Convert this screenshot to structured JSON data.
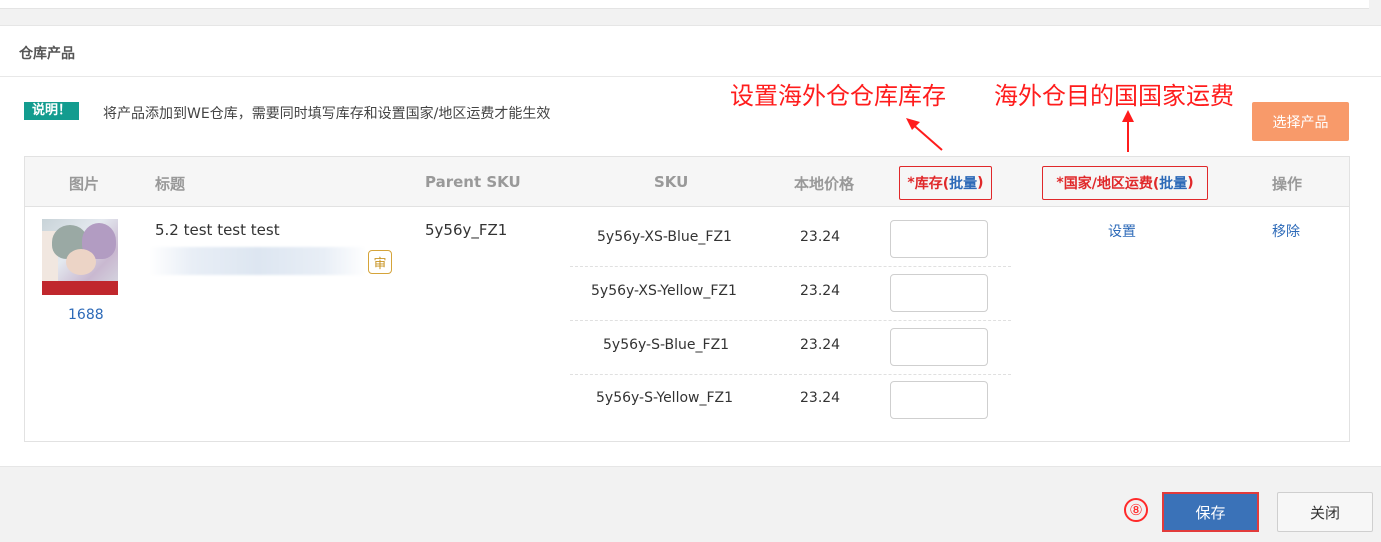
{
  "section": {
    "title": "仓库产品"
  },
  "tip": {
    "badge": "说明！",
    "text": "将产品添加到WE仓库，需要同时填写库存和设置国家/地区运费才能生效"
  },
  "annotations": {
    "stock_note": "设置海外仓仓库库存",
    "shipping_note": "海外仓目的国国家运费",
    "step_number": "⑧",
    "color": "#ff1c1c"
  },
  "select_button": "选择产品",
  "table": {
    "headers": {
      "image": "图片",
      "title": "标题",
      "parent_sku": "Parent SKU",
      "sku": "SKU",
      "price": "本地价格",
      "stock_required": "*",
      "stock_label": "库存(",
      "stock_batch": "批量",
      "stock_close": ")",
      "shipping_required": "*",
      "shipping_label": "国家/地区运费(",
      "shipping_batch": "批量",
      "shipping_close": ")",
      "actions": "操作"
    },
    "product": {
      "source": "1688",
      "title": "5.2 test test test",
      "audit_badge": "审",
      "parent_sku": "5y56y_FZ1",
      "shipping_action": "设置",
      "remove_action": "移除",
      "variants": [
        {
          "sku": "5y56y-XS-Blue_FZ1",
          "price": "23.24",
          "stock": ""
        },
        {
          "sku": "5y56y-XS-Yellow_FZ1",
          "price": "23.24",
          "stock": ""
        },
        {
          "sku": "5y56y-S-Blue_FZ1",
          "price": "23.24",
          "stock": ""
        },
        {
          "sku": "5y56y-S-Yellow_FZ1",
          "price": "23.24",
          "stock": ""
        }
      ]
    }
  },
  "footer": {
    "save": "保存",
    "close": "关闭"
  },
  "colors": {
    "accent": "#3a72b8",
    "badge": "#139c8f",
    "select_button": "#f89a6a",
    "highlight": "#e0282a"
  }
}
